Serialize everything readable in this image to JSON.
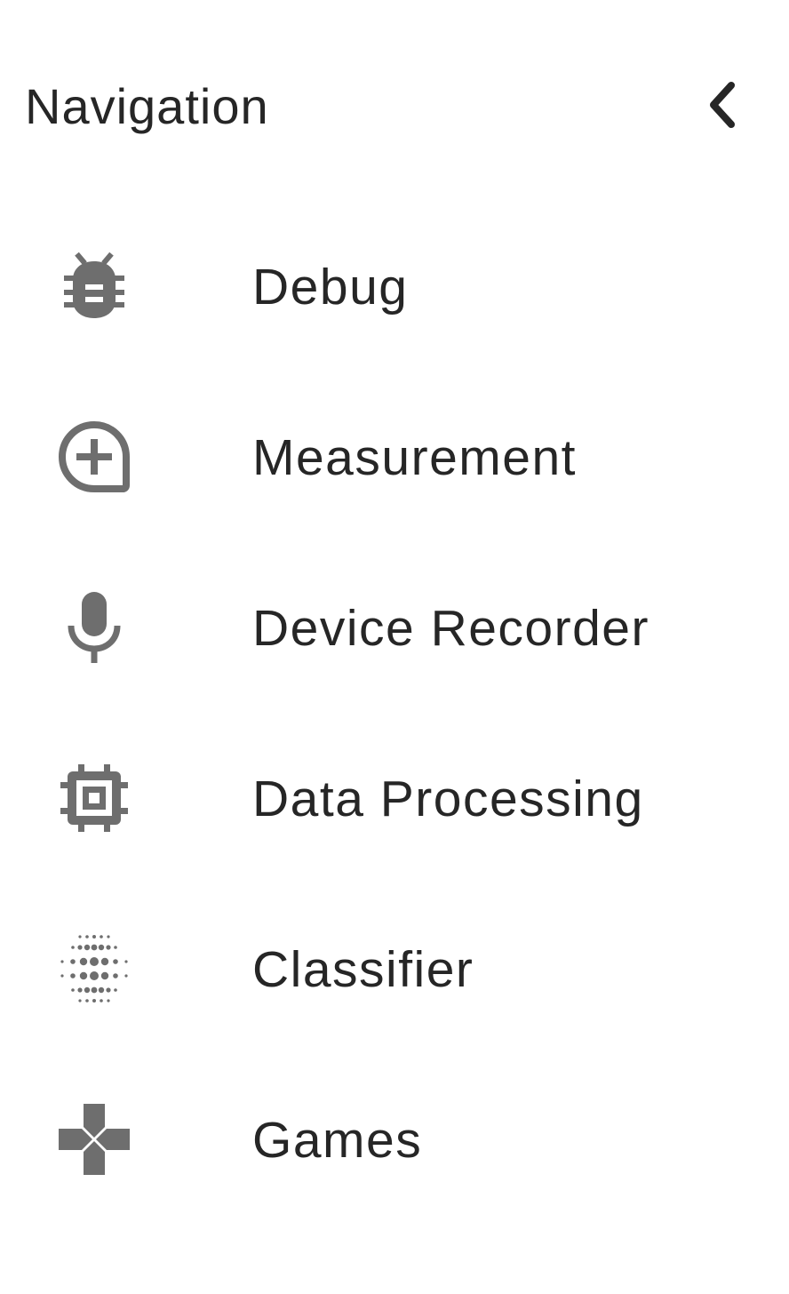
{
  "drawer": {
    "title": "Navigation",
    "collapse_icon": "chevron-left-icon"
  },
  "nav": {
    "items": [
      {
        "label": "Debug",
        "icon": "bug-icon"
      },
      {
        "label": "Measurement",
        "icon": "add-circle-tag-icon"
      },
      {
        "label": "Device Recorder",
        "icon": "microphone-icon"
      },
      {
        "label": "Data Processing",
        "icon": "chip-icon"
      },
      {
        "label": "Classifier",
        "icon": "dot-grid-icon"
      },
      {
        "label": "Games",
        "icon": "gamepad-icon"
      }
    ]
  },
  "colors": {
    "text": "#262626",
    "icon": "#6e6e6e",
    "background": "#ffffff"
  }
}
